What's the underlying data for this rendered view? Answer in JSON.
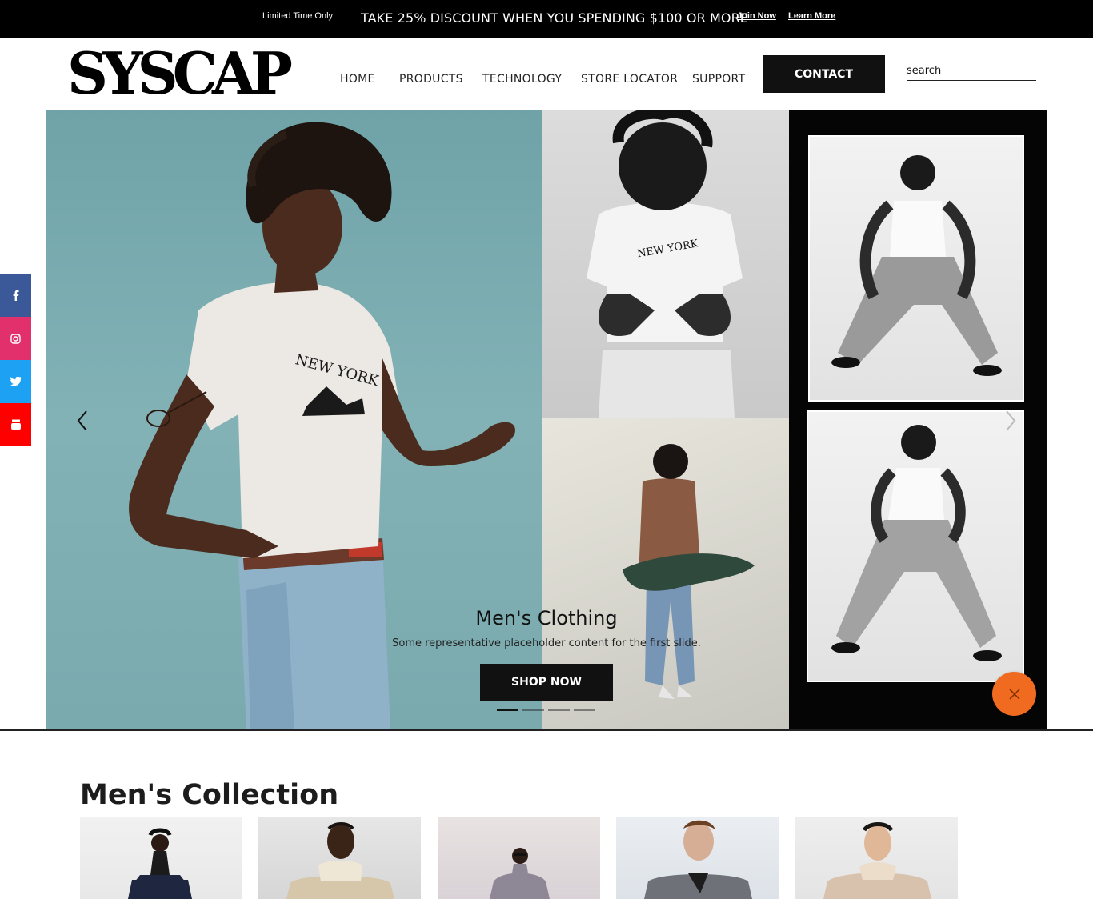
{
  "promo": {
    "limited": "Limited Time Only",
    "discount": "TAKE 25% DISCOUNT WHEN YOU SPENDING $100 OR MORE",
    "join": "Join Now",
    "learn": "Learn More"
  },
  "header": {
    "logo": "SYSCAP",
    "nav": [
      "HOME",
      "PRODUCTS",
      "TECHNOLOGY",
      "STORE LOCATOR",
      "SUPPORT"
    ],
    "contact": "CONTACT",
    "search_placeholder": "search"
  },
  "hero": {
    "title": "Men's Clothing",
    "subtitle": "Some representative placeholder content for the first slide.",
    "cta": "SHOP NOW",
    "slide_count": 4,
    "active_slide": 1,
    "shirt_print": "NEW YORK"
  },
  "social": [
    {
      "name": "facebook",
      "icon": "facebook-icon",
      "color": "#3b5998"
    },
    {
      "name": "instagram",
      "icon": "instagram-icon",
      "color": "#e1306c"
    },
    {
      "name": "twitter",
      "icon": "twitter-icon",
      "color": "#1da1f2"
    },
    {
      "name": "youtube",
      "icon": "youtube-icon",
      "color": "#ff0000"
    }
  ],
  "collection": {
    "title": "Men's Collection",
    "items": 5
  },
  "colors": {
    "accent": "#f06b1f",
    "dark": "#111111"
  }
}
